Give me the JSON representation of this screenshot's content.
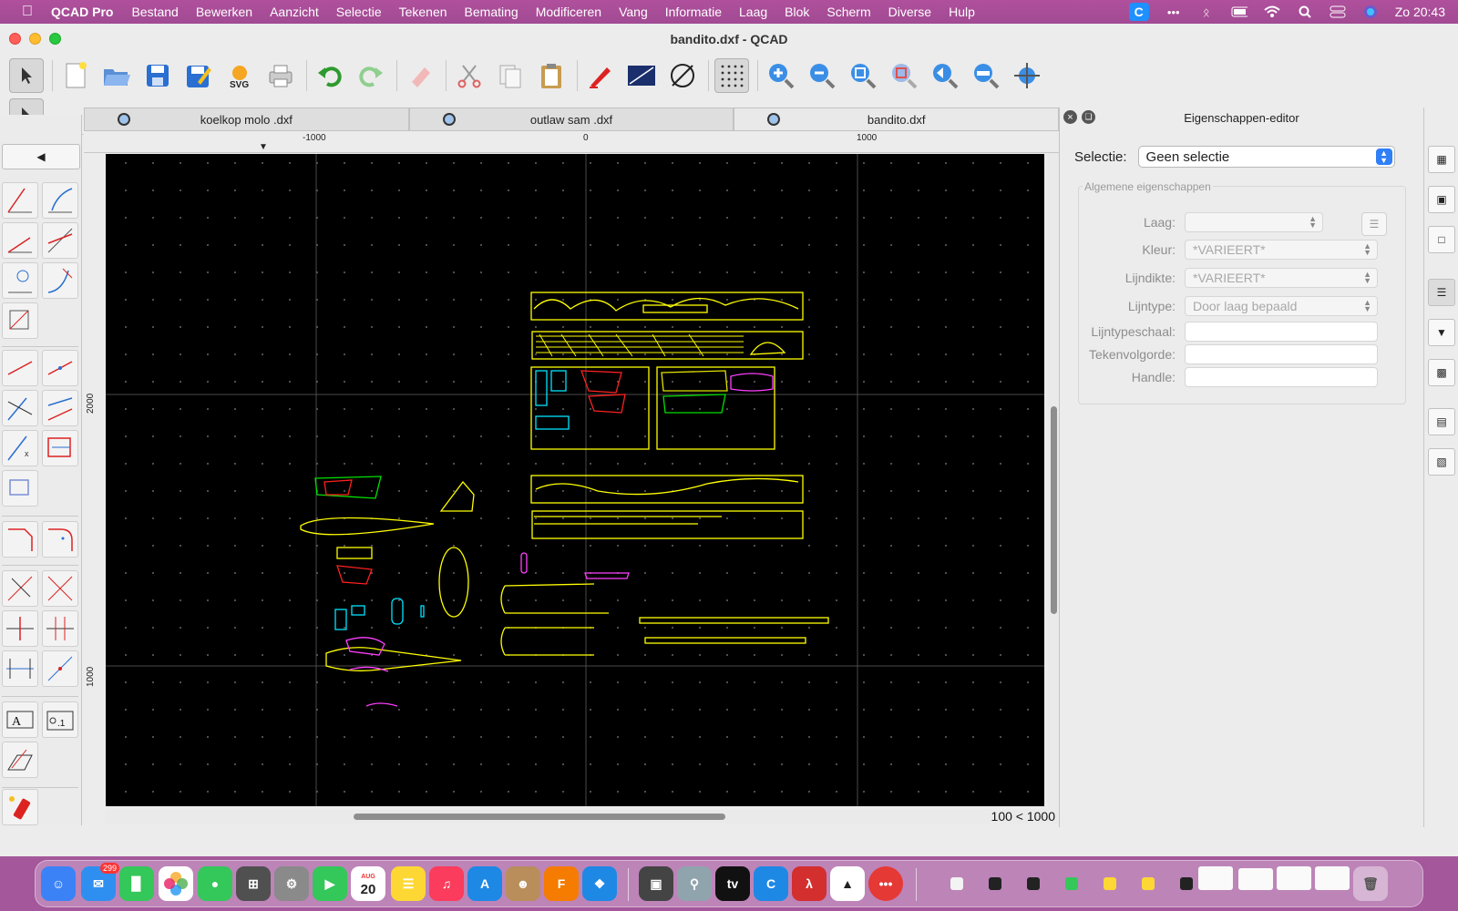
{
  "menubar": {
    "app_name": "QCAD Pro",
    "items": [
      "Bestand",
      "Bewerken",
      "Aanzicht",
      "Selectie",
      "Tekenen",
      "Bemating",
      "Modificeren",
      "Vang",
      "Informatie",
      "Laag",
      "Blok",
      "Scherm",
      "Diverse",
      "Hulp"
    ],
    "clock": "Zo  20:43"
  },
  "window": {
    "title": "bandito.dxf - QCAD"
  },
  "tabs": [
    {
      "label": "koelkop molo .dxf"
    },
    {
      "label": "outlaw sam .dxf"
    },
    {
      "label": "bandito.dxf"
    }
  ],
  "ruler": {
    "top_labels": [
      "-1000",
      "0",
      "1000"
    ],
    "left_labels": [
      "2000",
      "1000"
    ]
  },
  "status": {
    "grid": "100 < 1000"
  },
  "props": {
    "title": "Eigenschappen-editor",
    "selection_label": "Selectie:",
    "selection_value": "Geen selectie",
    "group_title": "Algemene eigenschappen",
    "rows": [
      {
        "label": "Laag:",
        "value": ""
      },
      {
        "label": "Kleur:",
        "value": "*VARIEERT*"
      },
      {
        "label": "Lijndikte:",
        "value": "*VARIEERT*"
      },
      {
        "label": "Lijntype:",
        "value": "Door laag bepaald"
      },
      {
        "label": "Lijntypeschaal:",
        "value": ""
      },
      {
        "label": "Tekenvolgorde:",
        "value": ""
      },
      {
        "label": "Handle:",
        "value": ""
      }
    ]
  },
  "dock": {
    "mail_badge": "299",
    "calendar_month": "AUG",
    "calendar_day": "20"
  }
}
